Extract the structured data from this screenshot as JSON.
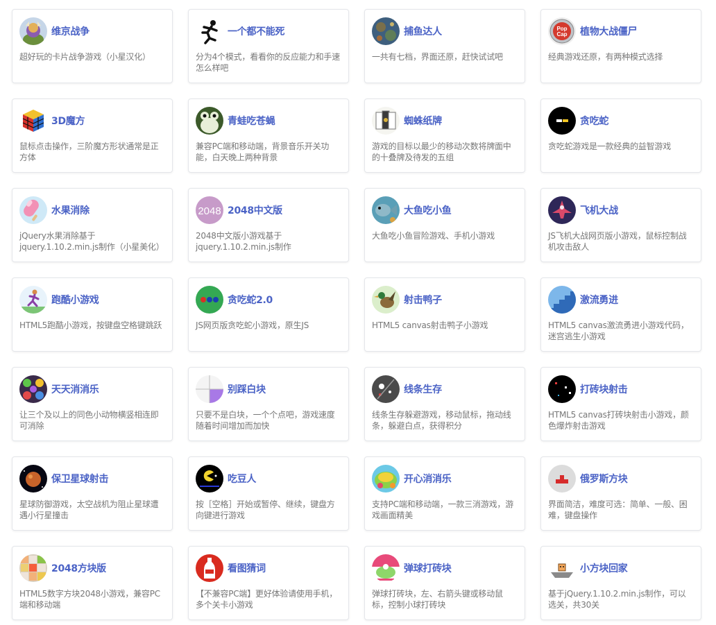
{
  "games": [
    {
      "title": "维京战争",
      "desc": "超好玩的卡片战争游戏（小星汉化）",
      "icon": "viking-icon"
    },
    {
      "title": "一个都不能死",
      "desc": "分为4个模式，看看你的反应能力和手速怎么样吧",
      "icon": "runner-icon"
    },
    {
      "title": "捕鱼达人",
      "desc": "一共有七档，界面还原，赶快试试吧",
      "icon": "fishing-icon"
    },
    {
      "title": "植物大战僵尸",
      "desc": "经典游戏还原，有两种模式选择",
      "icon": "popcap-icon"
    },
    {
      "title": "3D魔方",
      "desc": "鼠标点击操作，三阶魔方形状通常是正方体",
      "icon": "rubiks-cube-icon"
    },
    {
      "title": "青蛙吃苍蝇",
      "desc": "兼容PC端和移动端，背景音乐开关功能，白天晚上两种背景",
      "icon": "frog-icon"
    },
    {
      "title": "蜘蛛纸牌",
      "desc": "游戏的目标以最少的移动次数将牌面中的十叠牌及待发的五组",
      "icon": "spider-cards-icon"
    },
    {
      "title": "贪吃蛇",
      "desc": "贪吃蛇游戏是一款经典的益智游戏",
      "icon": "snake-icon"
    },
    {
      "title": "水果消除",
      "desc": "jQuery水果消除基于jquery.1.10.2.min.js制作（小星美化）",
      "icon": "popsicle-icon"
    },
    {
      "title": "2048中文版",
      "desc": "2048中文版小游戏基于jquery.1.10.2.min.js制作",
      "icon": "2048-icon",
      "icon_text": "2048"
    },
    {
      "title": "大鱼吃小鱼",
      "desc": "大鱼吃小鱼冒险游戏、手机小游戏",
      "icon": "big-fish-icon"
    },
    {
      "title": "飞机大战",
      "desc": "JS飞机大战网页版小游戏，鼠标控制战机攻击敌人",
      "icon": "plane-icon"
    },
    {
      "title": "跑酷小游戏",
      "desc": "HTML5跑酷小游戏，按键盘空格键跳跃",
      "icon": "parkour-icon"
    },
    {
      "title": "贪吃蛇2.0",
      "desc": "JS网页版贪吃蛇小游戏，原生JS",
      "icon": "snake2-icon"
    },
    {
      "title": "射击鸭子",
      "desc": "HTML5 canvas射击鸭子小游戏",
      "icon": "duck-icon"
    },
    {
      "title": "激流勇进",
      "desc": "HTML5 canvas激流勇进小游戏代码，迷宫逃生小游戏",
      "icon": "stairs-icon"
    },
    {
      "title": "天天消消乐",
      "desc": "让三个及以上的同色小动物横竖相连即可消除",
      "icon": "match3-icon"
    },
    {
      "title": "别踩白块",
      "desc": "只要不是白块，一个个点吧，游戏速度随着时间增加而加快",
      "icon": "white-tiles-icon"
    },
    {
      "title": "线条生存",
      "desc": "线条生存躲避游戏，移动鼠标，拖动线条，躲避白点，获得积分",
      "icon": "line-survival-icon"
    },
    {
      "title": "打砖块射击",
      "desc": "HTML5 canvas打砖块射击小游戏，颜色爆炸射击游戏",
      "icon": "brick-shooter-icon"
    },
    {
      "title": "保卫星球射击",
      "desc": "星球防御游戏，太空战机为阻止星球遭遇小行星撞击",
      "icon": "planet-icon"
    },
    {
      "title": "吃豆人",
      "desc": "按［空格］开始或暂停、继续，键盘方向键进行游戏",
      "icon": "pacman-icon"
    },
    {
      "title": "开心消消乐",
      "desc": "支持PC端和移动端，一款三消游戏，游戏画面精美",
      "icon": "happy-match-icon"
    },
    {
      "title": "俄罗斯方块",
      "desc": "界面简洁，难度可选：简单、一般、困难，键盘操作",
      "icon": "tetris-icon"
    },
    {
      "title": "2048方块版",
      "desc": "HTML5数字方块2048小游戏，兼容PC端和移动端",
      "icon": "2048-blocks-icon"
    },
    {
      "title": "看图猜词",
      "desc": "【不兼容PC端】更好体验请使用手机，多个关卡小游戏",
      "icon": "bottle-icon"
    },
    {
      "title": "弹球打砖块",
      "desc": "弹球打砖块，左、右箭头键或移动鼠标，控制小球打砖块",
      "icon": "ball-brick-icon"
    },
    {
      "title": "小方块回家",
      "desc": "基于jQuery.1.10.2.min.js制作，可以选关，共30关",
      "icon": "cube-home-icon"
    }
  ],
  "colors": {
    "title": "#4b63c6",
    "desc": "#777777",
    "border": "#e4e6ea"
  }
}
